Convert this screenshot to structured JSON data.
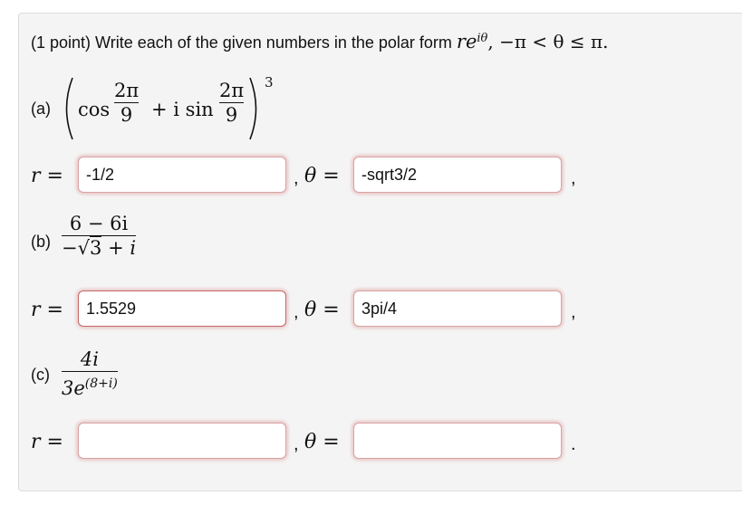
{
  "prompt": {
    "text": "(1 point) Write each of the given numbers in the polar form ",
    "form_r": "r",
    "form_e": "e",
    "form_exp": "iθ",
    "range": ", −π < θ ≤ π."
  },
  "parts": [
    {
      "label": "(a)",
      "expression": {
        "cos_word": "cos",
        "plus_i_sin": "+ i sin",
        "angle_num": "2π",
        "angle_den": "9",
        "power": "3"
      },
      "r_label": "r =",
      "theta_label": "θ =",
      "r_value": "-1/2",
      "theta_value": "-sqrt3/2",
      "trailing": ","
    },
    {
      "label": "(b)",
      "numerator": "6 − 6i",
      "denominator_minus": "−",
      "denominator_root": "3",
      "denominator_rest": "+ i",
      "r_label": "r =",
      "theta_label": "θ =",
      "r_value": "1.5529",
      "theta_value": "3pi/4",
      "trailing": ","
    },
    {
      "label": "(c)",
      "numerator": "4i",
      "denominator": "3e",
      "denominator_exp": "(8+i)",
      "r_label": "r =",
      "theta_label": "θ =",
      "r_value": "",
      "theta_value": "",
      "trailing": "."
    }
  ],
  "separator": ",",
  "colors": {
    "panel_bg": "#f4f4f4",
    "input_border": "#d9a3a3",
    "input_glow": "#d67878"
  }
}
